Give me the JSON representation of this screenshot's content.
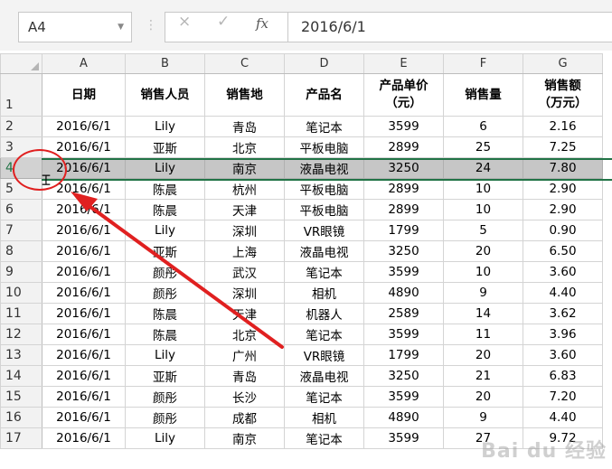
{
  "formula_bar": {
    "name_box": "A4",
    "cancel_icon": "×",
    "enter_icon": "✓",
    "fx_label": "fx",
    "formula_value": "2016/6/1"
  },
  "columns": [
    "A",
    "B",
    "C",
    "D",
    "E",
    "F",
    "G"
  ],
  "header_row": {
    "row_number": "1",
    "cells": [
      "日期",
      "销售人员",
      "销售地",
      "产品名",
      "产品单价\n（元）",
      "销售量",
      "销售额\n（万元）"
    ]
  },
  "rows": [
    {
      "n": "2",
      "cells": [
        "2016/6/1",
        "Lily",
        "青岛",
        "笔记本",
        "3599",
        "6",
        "2.16"
      ]
    },
    {
      "n": "3",
      "cells": [
        "2016/6/1",
        "亚斯",
        "北京",
        "平板电脑",
        "2899",
        "25",
        "7.25"
      ]
    },
    {
      "n": "4",
      "cells": [
        "2016/6/1",
        "Lily",
        "南京",
        "液晶电视",
        "3250",
        "24",
        "7.80"
      ]
    },
    {
      "n": "5",
      "cells": [
        "2016/6/1",
        "陈晨",
        "杭州",
        "平板电脑",
        "2899",
        "10",
        "2.90"
      ]
    },
    {
      "n": "6",
      "cells": [
        "2016/6/1",
        "陈晨",
        "天津",
        "平板电脑",
        "2899",
        "10",
        "2.90"
      ]
    },
    {
      "n": "7",
      "cells": [
        "2016/6/1",
        "Lily",
        "深圳",
        "VR眼镜",
        "1799",
        "5",
        "0.90"
      ]
    },
    {
      "n": "8",
      "cells": [
        "2016/6/1",
        "亚斯",
        "上海",
        "液晶电视",
        "3250",
        "20",
        "6.50"
      ]
    },
    {
      "n": "9",
      "cells": [
        "2016/6/1",
        "颜彤",
        "武汉",
        "笔记本",
        "3599",
        "10",
        "3.60"
      ]
    },
    {
      "n": "10",
      "cells": [
        "2016/6/1",
        "颜彤",
        "深圳",
        "相机",
        "4890",
        "9",
        "4.40"
      ]
    },
    {
      "n": "11",
      "cells": [
        "2016/6/1",
        "陈晨",
        "天津",
        "机器人",
        "2589",
        "14",
        "3.62"
      ]
    },
    {
      "n": "12",
      "cells": [
        "2016/6/1",
        "陈晨",
        "北京",
        "笔记本",
        "3599",
        "11",
        "3.96"
      ]
    },
    {
      "n": "13",
      "cells": [
        "2016/6/1",
        "Lily",
        "广州",
        "VR眼镜",
        "1799",
        "20",
        "3.60"
      ]
    },
    {
      "n": "14",
      "cells": [
        "2016/6/1",
        "亚斯",
        "青岛",
        "液晶电视",
        "3250",
        "21",
        "6.83"
      ]
    },
    {
      "n": "15",
      "cells": [
        "2016/6/1",
        "颜彤",
        "长沙",
        "笔记本",
        "3599",
        "20",
        "7.20"
      ]
    },
    {
      "n": "16",
      "cells": [
        "2016/6/1",
        "颜彤",
        "成都",
        "相机",
        "4890",
        "9",
        "4.40"
      ]
    },
    {
      "n": "17",
      "cells": [
        "2016/6/1",
        "Lily",
        "南京",
        "笔记本",
        "3599",
        "27",
        "9.72"
      ]
    }
  ],
  "selected_row": "4",
  "watermark": "Bai du 经验",
  "colors": {
    "selection": "#217346",
    "annotation": "#e02020"
  }
}
